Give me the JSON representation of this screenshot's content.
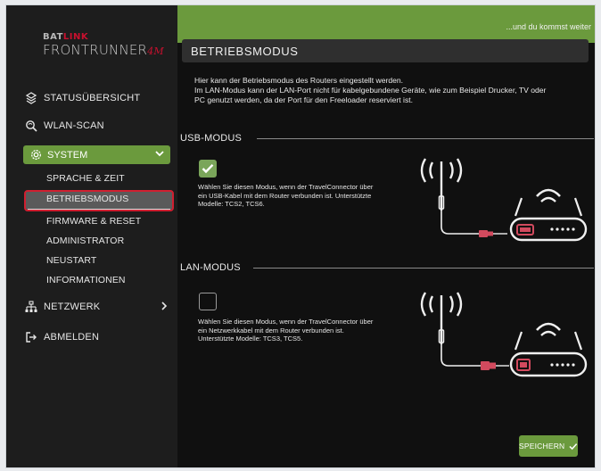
{
  "brand": {
    "line1_a": "BAT",
    "line1_b": "LINK",
    "line2": "FRONTRUNNER",
    "line2_suffix": "4M"
  },
  "header": {
    "slogan": "...und du kommst weiter"
  },
  "sidebar": {
    "items": [
      {
        "label": "STATUSÜBERSICHT",
        "icon": "status-overview-icon"
      },
      {
        "label": "WLAN-SCAN",
        "icon": "wlan-scan-icon"
      },
      {
        "label": "SYSTEM",
        "icon": "system-gear-icon"
      },
      {
        "label": "NETZWERK",
        "icon": "network-icon"
      },
      {
        "label": "ABMELDEN",
        "icon": "logout-icon"
      }
    ],
    "system_sub": [
      {
        "label": "SPRACHE & ZEIT"
      },
      {
        "label": "BETRIEBSMODUS"
      },
      {
        "label": "FIRMWARE & RESET"
      },
      {
        "label": "ADMINISTRATOR"
      },
      {
        "label": "NEUSTART"
      },
      {
        "label": "INFORMATIONEN"
      }
    ]
  },
  "main": {
    "title": "BETRIEBSMODUS",
    "intro_line1": "Hier kann der Betriebsmodus des Routers eingestellt werden.",
    "intro_line2": "Im LAN-Modus kann der LAN-Port nicht für kabelgebundene Geräte, wie zum Beispiel Drucker, TV oder",
    "intro_line3": "PC genutzt werden, da der Port für den Freeloader reserviert ist.",
    "usb": {
      "heading": "USB-MODUS",
      "checked": true,
      "desc1": "Wählen Sie diesen Modus, wenn der TravelConnector über",
      "desc2": "ein USB-Kabel mit dem Router verbunden ist. Unterstützte",
      "desc3": "Modelle: TCS2, TCS6."
    },
    "lan": {
      "heading": "LAN-MODUS",
      "checked": false,
      "desc1": "Wählen Sie diesen Modus, wenn der TravelConnector über",
      "desc2": "ein Netzwerkkabel mit dem Router verbunden ist.",
      "desc3": "Unterstützte Modelle: TCS3, TCS5."
    },
    "save_label": "SPEICHERN"
  },
  "colors": {
    "accent_green": "#6b9a3d",
    "highlight_red": "#d01f30",
    "cable_pink": "#d24a5e"
  }
}
